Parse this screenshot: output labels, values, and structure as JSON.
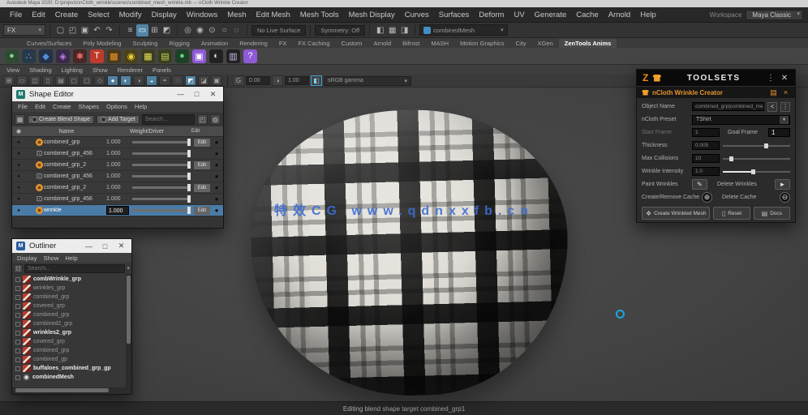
{
  "window": {
    "title": "Autodesk Maya 2020: D:\\projects\\nCloth_wrinkle\\scenes\\combined_mesh_wrinkle.mb --- nCloth Wrinkle Creator",
    "workspace_label": "Workspace",
    "workspace_value": "Maya Classic"
  },
  "menubar": [
    "File",
    "Edit",
    "Create",
    "Select",
    "Modify",
    "Display",
    "Windows",
    "Mesh",
    "Edit Mesh",
    "Mesh Tools",
    "Mesh Display",
    "Curves",
    "Surfaces",
    "Deform",
    "UV",
    "Generate",
    "Cache",
    "Arnold",
    "Help"
  ],
  "statusline": {
    "menu_set": "FX",
    "file_icons": [
      {
        "name": "new-scene-icon",
        "glyph": "▢"
      },
      {
        "name": "open-scene-icon",
        "glyph": "◰"
      },
      {
        "name": "save-scene-icon",
        "glyph": "▣"
      },
      {
        "name": "undo-icon",
        "glyph": "↶"
      },
      {
        "name": "redo-icon",
        "glyph": "↷"
      }
    ],
    "selection_icons": [
      {
        "name": "select-hierarchy-icon",
        "glyph": "≡"
      },
      {
        "name": "select-object-icon",
        "glyph": "▭",
        "active": true
      },
      {
        "name": "select-component-icon",
        "glyph": "⊞"
      },
      {
        "name": "highlight-selection-icon",
        "glyph": "◩"
      }
    ],
    "snap_icons": [
      {
        "name": "snap-grid-icon",
        "glyph": "◎"
      },
      {
        "name": "snap-curve-icon",
        "glyph": "◉"
      },
      {
        "name": "snap-point-icon",
        "glyph": "⊙"
      },
      {
        "name": "snap-plane-icon",
        "glyph": "○"
      },
      {
        "name": "snap-view-icon",
        "glyph": "◌"
      }
    ],
    "live_surface": "No Live Surface",
    "symmetry": "Symmetry: Off",
    "render_icons": [
      {
        "name": "open-render-view-icon",
        "glyph": "◧"
      },
      {
        "name": "render-frame-icon",
        "glyph": "▦"
      },
      {
        "name": "render-settings-icon",
        "glyph": "◨"
      }
    ],
    "character_set": "combinedMesh"
  },
  "shelf": {
    "tabs": [
      {
        "label": "Curves/Surfaces"
      },
      {
        "label": "Poly Modeling"
      },
      {
        "label": "Sculpting"
      },
      {
        "label": "Rigging"
      },
      {
        "label": "Animation"
      },
      {
        "label": "Rendering"
      },
      {
        "label": "FX"
      },
      {
        "label": "FX Caching"
      },
      {
        "label": "Custom"
      },
      {
        "label": "Arnold"
      },
      {
        "label": "Bifrost"
      },
      {
        "label": "MASH"
      },
      {
        "label": "Motion Graphics"
      },
      {
        "label": "City"
      },
      {
        "label": "XGen"
      },
      {
        "label": "ZenTools Anims",
        "active": true
      }
    ],
    "icons": [
      {
        "name": "nparticles-icon",
        "glyph": "●",
        "css": "color:#7fd38a;background:#2e4a33"
      },
      {
        "name": "nucleus-icon",
        "glyph": "∴",
        "css": "color:#6fb6e8;background:#27394a"
      },
      {
        "name": "ncloth-icon",
        "glyph": "◆",
        "css": "color:#4f8fd6;background:#233247"
      },
      {
        "name": "nhair-icon",
        "glyph": "◈",
        "css": "color:#b87fe8;background:#3a2a4a"
      },
      {
        "name": "nconstraint-icon",
        "glyph": "✱",
        "css": "color:#e86a6a;background:#4a2626"
      },
      {
        "name": "paint-effects-icon",
        "glyph": "T",
        "css": "color:#fff;background:#c0392b"
      },
      {
        "name": "fluids-icon",
        "glyph": "▩",
        "css": "color:#e8952f;background:#4a3a1a"
      },
      {
        "name": "fire-icon",
        "glyph": "◉",
        "css": "color:#f0d030;background:#4a431a"
      },
      {
        "name": "checker-icon",
        "glyph": "▦",
        "css": "color:#e8e05a;background:#3c3c20"
      },
      {
        "name": "ocean-icon",
        "glyph": "▤",
        "css": "color:#cdd65a;background:#37401e"
      },
      {
        "name": "boss-icon",
        "glyph": "●",
        "css": "color:#5ad67a;background:#1e4029"
      },
      {
        "name": "camera-icon",
        "glyph": "▣",
        "css": "color:#fff;background:#8e5ad6"
      },
      {
        "name": "mash-sphere-icon",
        "glyph": "◐",
        "css": "color:#e0d0f5;background:#222"
      },
      {
        "name": "mash-graph-icon",
        "glyph": "▥",
        "css": "color:#d0b8f0;background:#222"
      },
      {
        "name": "help-icon",
        "glyph": "?",
        "css": "color:#fff;background:#8e5ad6"
      }
    ]
  },
  "panel_menus": [
    "View",
    "Shading",
    "Lighting",
    "Show",
    "Renderer",
    "Panels"
  ],
  "viewport_toolbar": {
    "icons": [
      {
        "name": "grid-toggle-icon",
        "glyph": "⊞"
      },
      {
        "name": "film-gate-icon",
        "glyph": "▭"
      },
      {
        "name": "resolution-gate-icon",
        "glyph": "◫"
      },
      {
        "name": "gate-mask-icon",
        "glyph": "▯"
      },
      {
        "name": "field-chart-icon",
        "glyph": "▤"
      },
      {
        "name": "safe-action-icon",
        "glyph": "◻"
      },
      {
        "name": "safe-title-icon",
        "glyph": "▢"
      },
      {
        "name": "wireframe-icon",
        "glyph": "◇"
      },
      {
        "name": "shaded-icon",
        "glyph": "●",
        "active": true
      },
      {
        "name": "textured-icon",
        "glyph": "◐",
        "active": true
      },
      {
        "name": "lights-icon",
        "glyph": "◑"
      },
      {
        "name": "shadows-icon",
        "glyph": "◒",
        "active": true
      },
      {
        "name": "ambient-occlusion-icon",
        "glyph": "◓"
      },
      {
        "name": "motion-blur-icon",
        "glyph": "◌"
      },
      {
        "name": "isolate-select-icon",
        "glyph": "◩",
        "active": true
      },
      {
        "name": "xray-icon",
        "glyph": "◪"
      },
      {
        "name": "camera-attrs-icon",
        "glyph": "▣"
      }
    ],
    "exposure_icon": "G",
    "exposure": "0.00",
    "gamma": "1.00",
    "view_transform": "sRGB gamma"
  },
  "shape_editor": {
    "title": "Shape Editor",
    "window_buttons": {
      "minimize": "—",
      "maximize": "□",
      "close": "✕"
    },
    "menus": [
      "File",
      "Edit",
      "Create",
      "Shapes",
      "Options",
      "Help"
    ],
    "create_button": "Create Blend Shape",
    "add_button": "Add Target",
    "search_placeholder": "Search...",
    "columns": {
      "name": "Name",
      "weight": "Weight/Driver",
      "edit": "Edit"
    },
    "rows": [
      {
        "name": "combined_grp",
        "value": "1.000",
        "icon": "target",
        "indent": true,
        "edit": true,
        "edit_label": "Edit"
      },
      {
        "name": "combined_grp_456",
        "value": "1.000",
        "icon": "group"
      },
      {
        "name": "combined_grp_2",
        "value": "1.000",
        "icon": "target",
        "indent": true,
        "edit": true,
        "edit_label": "Edit"
      },
      {
        "name": "combined_grp_456",
        "value": "1.000",
        "icon": "group"
      },
      {
        "name": "combined_grp_2",
        "value": "1.000",
        "icon": "target",
        "indent": true,
        "edit": true,
        "edit_label": "Edit"
      },
      {
        "name": "combined_grp_456",
        "value": "1.000",
        "icon": "group"
      },
      {
        "name": "wrinkle",
        "value": "1.000",
        "icon": "target",
        "indent": true,
        "edit": true,
        "edit_label": "Edit",
        "selected": true
      }
    ]
  },
  "outliner": {
    "title": "Outliner",
    "window_buttons": {
      "minimize": "—",
      "maximize": "□",
      "close": "✕"
    },
    "menus": [
      "Display",
      "Show",
      "Help"
    ],
    "search_placeholder": "Search...",
    "items": [
      {
        "name": "combWrinkle_grp",
        "icon": "book",
        "bright": true
      },
      {
        "name": "wrinkles_grp",
        "icon": "book"
      },
      {
        "name": "combined_grp",
        "icon": "book"
      },
      {
        "name": "covered_grp",
        "icon": "book"
      },
      {
        "name": "combined_grp",
        "icon": "book"
      },
      {
        "name": "combined2_grp",
        "icon": "book"
      },
      {
        "name": "wrinkles2_grp",
        "icon": "book",
        "bright": true
      },
      {
        "name": "covered_grp",
        "icon": "book"
      },
      {
        "name": "combined_grp",
        "icon": "book"
      },
      {
        "name": "combined_gp",
        "icon": "book"
      },
      {
        "name": "buffaloes_combined_grp_gp",
        "icon": "book",
        "bright": true
      },
      {
        "name": "combinedMesh",
        "icon": "mesh",
        "bright": true
      }
    ]
  },
  "toolsets": {
    "logo": "Z",
    "title": "TOOLSETS",
    "menu_button": "⋮",
    "close_button": "✕",
    "tool_title": "nCloth Wrinkle Creator",
    "object_name_label": "Object Name",
    "object_name_value": "combined_grp|combined_mesh_res",
    "prev_button": "<",
    "more_button": "⋮",
    "preset_label": "nCloth Preset",
    "preset_value": "TShirt",
    "start_frame_label": "Start Frame",
    "start_frame_value": "1",
    "goal_frame_label": "Goal Frame",
    "goal_frame_value": "1",
    "thickness_label": "Thickness",
    "thickness_value": "0.005",
    "max_collisions_label": "Max Collisions",
    "max_collisions_value": "10",
    "intensity_label": "Wrinkle Intensity",
    "intensity_value": "1.0",
    "paint_label": "Paint Wrinkles",
    "delete_wrinkles_label": "Delete Wrinkles",
    "cache_label": "Create/Remove Cache",
    "delete_cache_label": "Delete Cache",
    "create_mesh_button": "Create Wrinkled Mesh",
    "reset_button": "Reset",
    "docs_button": "Docs",
    "accent_color": "#e8952f"
  },
  "viewport": {
    "watermark": "特效CG www.qdnxxfb.cn",
    "helpline": "Editing blend shape target combined_grp1"
  }
}
